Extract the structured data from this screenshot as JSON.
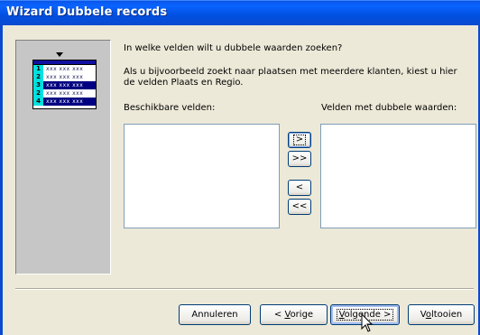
{
  "window": {
    "title": "Wizard Dubbele records"
  },
  "graphic": {
    "rows": [
      {
        "num": "1",
        "cells": "xxx xxx xxx",
        "highlighted": false
      },
      {
        "num": "2",
        "cells": "xxx xxx xxx",
        "highlighted": false
      },
      {
        "num": "3",
        "cells": "xxx xxx xxx",
        "highlighted": true
      },
      {
        "num": "2",
        "cells": "xxx xxx xxx",
        "highlighted": false
      },
      {
        "num": "4",
        "cells": "xxx xxx xxx",
        "highlighted": true
      }
    ]
  },
  "content": {
    "question": "In welke velden wilt u dubbele waarden zoeken?",
    "hint": "Als u bijvoorbeeld zoekt naar plaatsen met meerdere klanten, kiest u hier de velden Plaats en Regio.",
    "available_label": "Beschikbare velden:",
    "duplicate_label": "Velden met dubbele waarden:"
  },
  "move_buttons": {
    "add_one": ">",
    "add_all": ">>",
    "remove_one": "<",
    "remove_all": "<<"
  },
  "footer": {
    "cancel": "Annuleren",
    "back_prefix": "< ",
    "back_hotkey": "V",
    "back_rest": "orige",
    "next_hotkey": "V",
    "next_rest": "olgende >",
    "finish_prefix": "V",
    "finish_hotkey": "o",
    "finish_rest": "ltooien"
  }
}
